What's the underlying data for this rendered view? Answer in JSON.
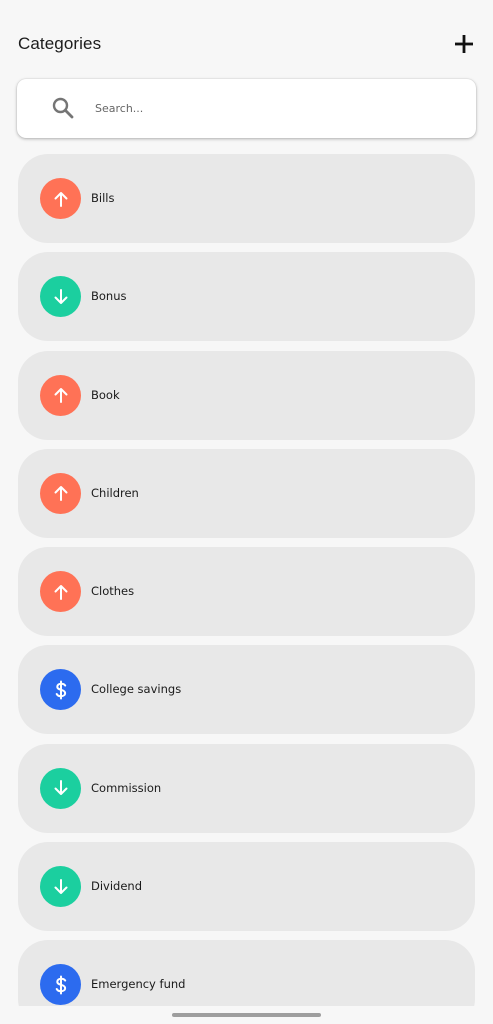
{
  "header": {
    "title": "Categories",
    "add_icon": "plus-icon"
  },
  "search": {
    "placeholder": "Search...",
    "value": "",
    "icon": "search-icon"
  },
  "colors": {
    "expense": "#ff7256",
    "income": "#1bcf9f",
    "savings": "#2c6bef",
    "item_bg": "#e8e8e8",
    "page_bg": "#f7f7f7"
  },
  "categories": [
    {
      "label": "Bills",
      "kind": "expense",
      "icon": "arrow-up-icon"
    },
    {
      "label": "Bonus",
      "kind": "income",
      "icon": "arrow-down-icon"
    },
    {
      "label": "Book",
      "kind": "expense",
      "icon": "arrow-up-icon"
    },
    {
      "label": "Children",
      "kind": "expense",
      "icon": "arrow-up-icon"
    },
    {
      "label": "Clothes",
      "kind": "expense",
      "icon": "arrow-up-icon"
    },
    {
      "label": "College savings",
      "kind": "savings",
      "icon": "dollar-icon"
    },
    {
      "label": "Commission",
      "kind": "income",
      "icon": "arrow-down-icon"
    },
    {
      "label": "Dividend",
      "kind": "income",
      "icon": "arrow-down-icon"
    },
    {
      "label": "Emergency fund",
      "kind": "savings",
      "icon": "dollar-icon"
    }
  ]
}
